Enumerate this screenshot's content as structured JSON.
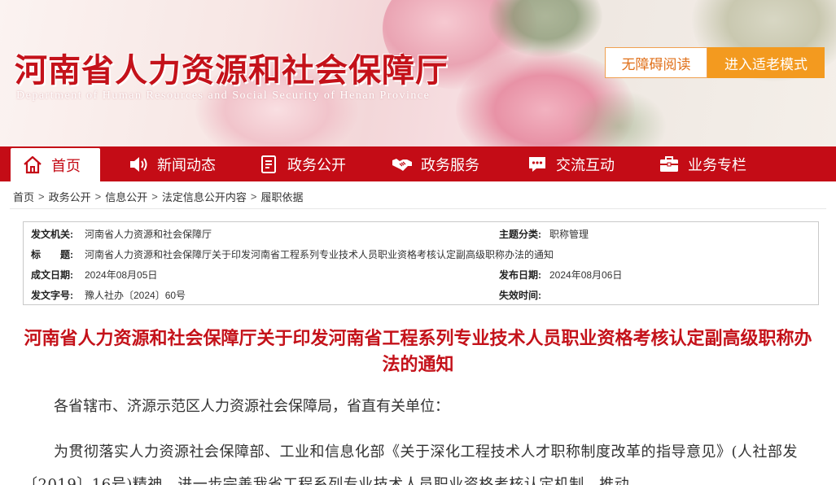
{
  "header": {
    "title": "河南省人力资源和社会保障厅",
    "subtitle": "Department of Human Resources and Social Security of Henan Province",
    "accessible_btn": "无障碍阅读",
    "elder_btn": "进入适老模式"
  },
  "nav": {
    "items": [
      {
        "label": "首页",
        "icon": "home-icon"
      },
      {
        "label": "新闻动态",
        "icon": "speaker-icon"
      },
      {
        "label": "政务公开",
        "icon": "document-icon"
      },
      {
        "label": "政务服务",
        "icon": "handshake-icon"
      },
      {
        "label": "交流互动",
        "icon": "chat-icon"
      },
      {
        "label": "业务专栏",
        "icon": "briefcase-icon"
      }
    ]
  },
  "breadcrumb": [
    "首页",
    "政务公开",
    "信息公开",
    "法定信息公开内容",
    "履职依据"
  ],
  "meta": {
    "issuer_label": "发文机关:",
    "issuer": "河南省人力资源和社会保障厅",
    "category_label": "主题分类:",
    "category": "职称管理",
    "title_label": "标　　题:",
    "title": "河南省人力资源和社会保障厅关于印发河南省工程系列专业技术人员职业资格考核认定副高级职称办法的通知",
    "written_label": "成文日期:",
    "written": "2024年08月05日",
    "published_label": "发布日期:",
    "published": "2024年08月06日",
    "doc_no_label": "发文字号:",
    "doc_no": "豫人社办〔2024〕60号",
    "expiry_label": "失效时间:",
    "expiry": ""
  },
  "article": {
    "title": "河南省人力资源和社会保障厅关于印发河南省工程系列专业技术人员职业资格考核认定副高级职称办法的通知",
    "salutation": "各省辖市、济源示范区人力资源社会保障局，省直有关单位：",
    "paragraph1": "为贯彻落实人力资源社会保障部、工业和信息化部《关于深化工程技术人才职称制度改革的指导意见》(人社部发〔2019〕16号)精神，进一步完善我省工程系列专业技术人员职业资格考核认定机制，推动"
  },
  "colors": {
    "brand_red": "#c40c16",
    "title_red": "#c4121a",
    "accent_orange": "#f39a1f"
  }
}
